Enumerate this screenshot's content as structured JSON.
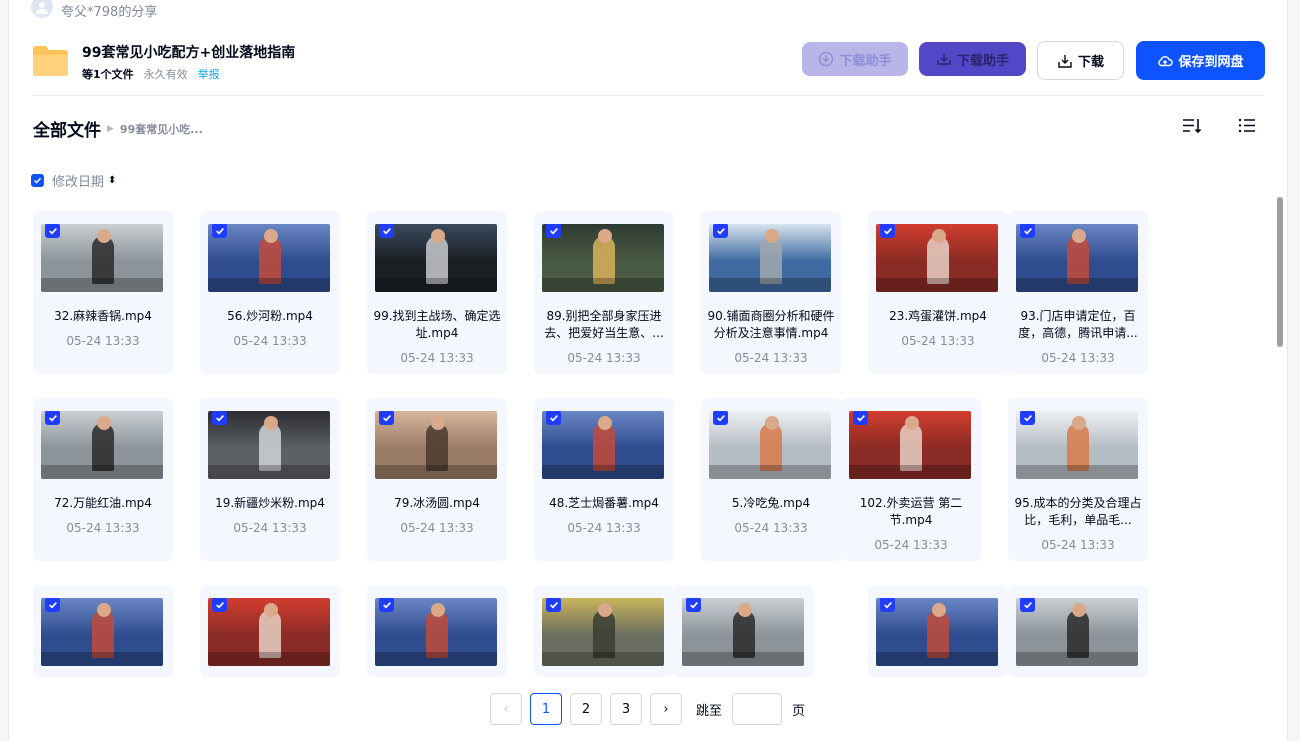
{
  "share": {
    "sharer_name": "夸父*798的分享"
  },
  "header": {
    "title": "99套常见小吃配方+创业落地指南",
    "file_count": "等1个文件",
    "validity": "永久有效",
    "report": "举报",
    "buttons": {
      "helper_disabled": "下载助手",
      "helper": "下载助手",
      "download": "下载",
      "save": "保存到网盘"
    }
  },
  "breadcrumb": {
    "root": "全部文件",
    "current": "99套常见小吃..."
  },
  "sort": {
    "label": "修改日期",
    "arrow": "⬍"
  },
  "colors": {
    "accent": "#0d53ff",
    "helper": "#5247c6",
    "tile_bg": "#f5f7ff"
  },
  "files": [
    {
      "name": "32.麻辣香锅.mp4",
      "date": "05-24 13:33",
      "scene": "kitchen"
    },
    {
      "name": "56.炒河粉.mp4",
      "date": "05-24 13:33",
      "scene": "crowd"
    },
    {
      "name": "99.找到主战场、确定选址.mp4",
      "date": "05-24 13:33",
      "scene": "presenter"
    },
    {
      "name": "89.别把全部身家压进去、把爱好当生意、...",
      "date": "05-24 13:33",
      "scene": "screen"
    },
    {
      "name": "90.铺面商圈分析和硬件分析及注意事情.mp4",
      "date": "05-24 13:33",
      "scene": "office"
    },
    {
      "name": "23.鸡蛋灌饼.mp4",
      "date": "05-24 13:33",
      "scene": "redcrowd"
    },
    {
      "name": "93.门店申请定位，百度，高德，腾讯申请...",
      "date": "05-24 13:33",
      "scene": "crowd"
    },
    {
      "name": "72.万能红油.mp4",
      "date": "05-24 13:33",
      "scene": "kitchen"
    },
    {
      "name": "19.新疆炒米粉.mp4",
      "date": "05-24 13:33",
      "scene": "wok"
    },
    {
      "name": "79.冰汤圆.mp4",
      "date": "05-24 13:33",
      "scene": "pot"
    },
    {
      "name": "48.芝士焗番薯.mp4",
      "date": "05-24 13:33",
      "scene": "crowd"
    },
    {
      "name": "5.冷吃兔.mp4",
      "date": "05-24 13:33",
      "scene": "chef"
    },
    {
      "name": "102.外卖运营 第二节.mp4",
      "date": "05-24 13:33",
      "scene": "redcrowd"
    },
    {
      "name": "95.成本的分类及合理占比，毛利，单品毛...",
      "date": "05-24 13:33",
      "scene": "chef"
    },
    {
      "name": "",
      "date": "",
      "scene": "crowd"
    },
    {
      "name": "",
      "date": "",
      "scene": "redcrowd"
    },
    {
      "name": "",
      "date": "",
      "scene": "crowd"
    },
    {
      "name": "",
      "date": "",
      "scene": "food"
    },
    {
      "name": "",
      "date": "",
      "scene": "kitchen"
    },
    {
      "name": "",
      "date": "",
      "scene": "crowd"
    },
    {
      "name": "",
      "date": "",
      "scene": "kitchen"
    }
  ],
  "pagination": {
    "prev": "‹",
    "pages": [
      "1",
      "2",
      "3"
    ],
    "next": "›",
    "jump_label": "跳至",
    "page_unit": "页",
    "current_page": 1
  }
}
